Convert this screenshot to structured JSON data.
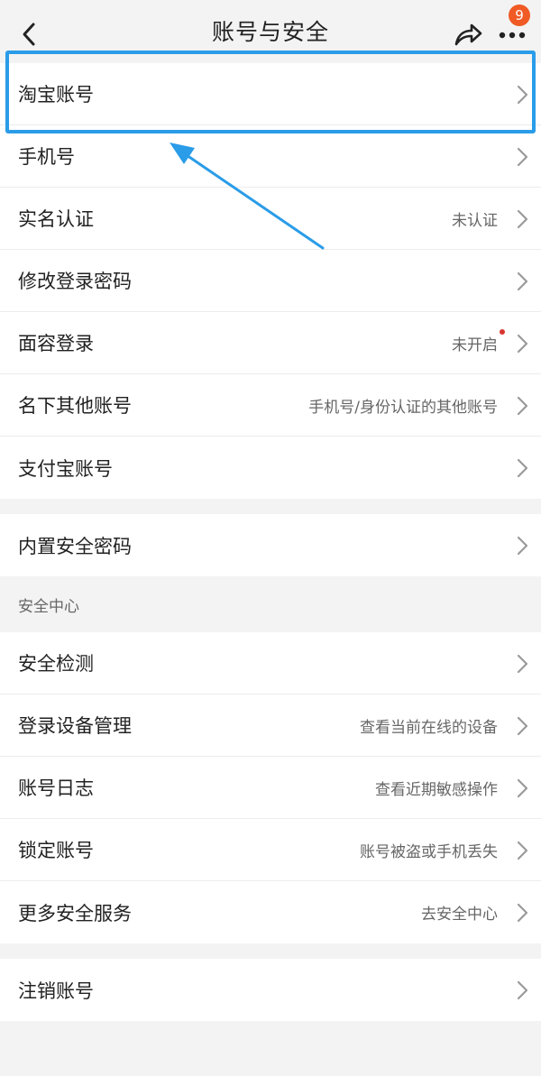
{
  "header": {
    "title": "账号与安全",
    "badge_count": "9"
  },
  "account_group": [
    {
      "label": "淘宝账号",
      "value": ""
    },
    {
      "label": "手机号",
      "value": ""
    },
    {
      "label": "实名认证",
      "value": "未认证"
    },
    {
      "label": "修改登录密码",
      "value": ""
    },
    {
      "label": "面容登录",
      "value": "未开启"
    },
    {
      "label": "名下其他账号",
      "value": "手机号/身份认证的其他账号"
    },
    {
      "label": "支付宝账号",
      "value": ""
    }
  ],
  "password_group": [
    {
      "label": "内置安全密码",
      "value": ""
    }
  ],
  "security_center": {
    "heading": "安全中心",
    "items": [
      {
        "label": "安全检测",
        "value": ""
      },
      {
        "label": "登录设备管理",
        "value": "查看当前在线的设备"
      },
      {
        "label": "账号日志",
        "value": "查看近期敏感操作"
      },
      {
        "label": "锁定账号",
        "value": "账号被盗或手机丢失"
      },
      {
        "label": "更多安全服务",
        "value": "去安全中心"
      }
    ]
  },
  "cancel_group": [
    {
      "label": "注销账号",
      "value": ""
    }
  ],
  "colors": {
    "accent_highlight": "#2a9ce8",
    "badge": "#f05a24",
    "notice_dot": "#d9352f"
  }
}
